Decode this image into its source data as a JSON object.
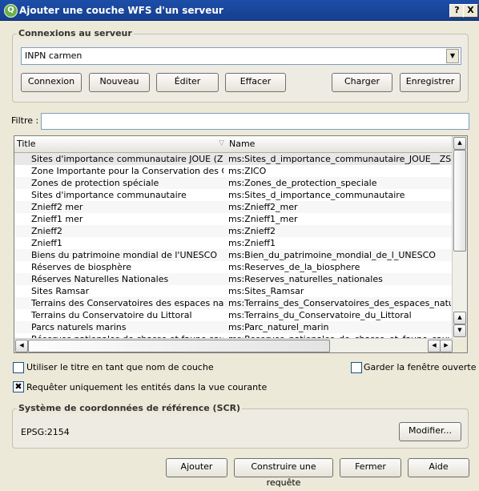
{
  "window": {
    "title": "Ajouter une couche WFS d'un serveur",
    "help_glyph": "?",
    "close_glyph": "X",
    "logo": "Q"
  },
  "connections": {
    "group_title": "Connexions au serveur",
    "selected": "INPN carmen",
    "buttons": {
      "connect": "Connexion",
      "new": "Nouveau",
      "edit": "Éditer",
      "delete": "Effacer",
      "load": "Charger",
      "save": "Enregistrer"
    }
  },
  "filter": {
    "label": "Filtre :",
    "value": ""
  },
  "table": {
    "columns": [
      "Title",
      "Name"
    ],
    "rows": [
      [
        "Sites d'importance communautaire JOUE (ZSC,S...",
        "ms:Sites_d_importance_communautaire_JOUE__ZSC_S..."
      ],
      [
        "Zone Importante pour la Conservation des Oise...",
        "ms:ZICO"
      ],
      [
        "Zones de protection spéciale",
        "ms:Zones_de_protection_speciale"
      ],
      [
        "Sites d'importance communautaire",
        "ms:Sites_d_importance_communautaire"
      ],
      [
        "Znieff2 mer",
        "ms:Znieff2_mer"
      ],
      [
        "Znieff1 mer",
        "ms:Znieff1_mer"
      ],
      [
        "Znieff2",
        "ms:Znieff2"
      ],
      [
        "Znieff1",
        "ms:Znieff1"
      ],
      [
        "Biens du patrimoine mondial de l'UNESCO",
        "ms:Bien_du_patrimoine_mondial_de_l_UNESCO"
      ],
      [
        "Réserves de biosphère",
        "ms:Reserves_de_la_biosphere"
      ],
      [
        "Réserves Naturelles Nationales",
        "ms:Reserves_naturelles_nationales"
      ],
      [
        "Sites Ramsar",
        "ms:Sites_Ramsar"
      ],
      [
        "Terrains des Conservatoires des espaces naturels",
        "ms:Terrains_des_Conservatoires_des_espaces_naturels"
      ],
      [
        "Terrains du Conservatoire du Littoral",
        "ms:Terrains_du_Conservatoire_du_Littoral"
      ],
      [
        "Parcs naturels marins",
        "ms:Parc_naturel_marin"
      ],
      [
        "Réserves nationales de chasse et faune sauvage",
        "ms:Reserves_nationales_de_chasse_et_faune_sauvage"
      ]
    ]
  },
  "options": {
    "use_title": {
      "label": "Utiliser le titre en tant que nom de couche",
      "checked": false
    },
    "keep_open": {
      "label": "Garder la fenêtre ouverte",
      "checked": false
    },
    "current_view": {
      "label": "Requêter uniquement les entités dans la vue courante",
      "checked": true,
      "mark": "✖"
    }
  },
  "crs": {
    "group_title": "Système de coordonnées de référence (SCR)",
    "value": "EPSG:2154",
    "modify": "Modifier..."
  },
  "footer": {
    "add": "Ajouter",
    "build_query": "Construire une requête",
    "close": "Fermer",
    "help": "Aide"
  }
}
